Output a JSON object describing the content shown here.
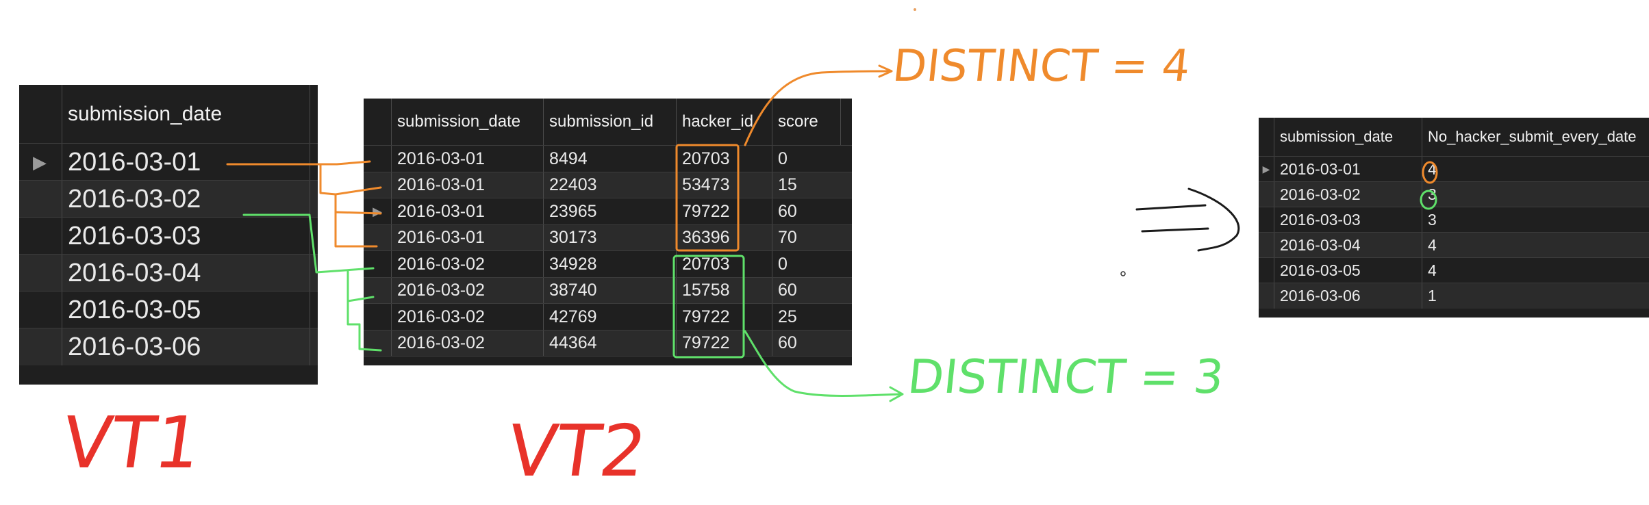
{
  "vt1": {
    "header": "submission_date",
    "rows": [
      "2016-03-01",
      "2016-03-02",
      "2016-03-03",
      "2016-03-04",
      "2016-03-05",
      "2016-03-06"
    ],
    "marker": "▶"
  },
  "vt2": {
    "headers": [
      "submission_date",
      "submission_id",
      "hacker_id",
      "score"
    ],
    "rows": [
      [
        "2016-03-01",
        "8494",
        "20703",
        "0"
      ],
      [
        "2016-03-01",
        "22403",
        "53473",
        "15"
      ],
      [
        "2016-03-01",
        "23965",
        "79722",
        "60"
      ],
      [
        "2016-03-01",
        "30173",
        "36396",
        "70"
      ],
      [
        "2016-03-02",
        "34928",
        "20703",
        "0"
      ],
      [
        "2016-03-02",
        "38740",
        "15758",
        "60"
      ],
      [
        "2016-03-02",
        "42769",
        "79722",
        "25"
      ],
      [
        "2016-03-02",
        "44364",
        "79722",
        "60"
      ]
    ]
  },
  "result": {
    "headers": [
      "submission_date",
      "No_hacker_submit_every_date"
    ],
    "rows": [
      [
        "2016-03-01",
        "4"
      ],
      [
        "2016-03-02",
        "3"
      ],
      [
        "2016-03-03",
        "3"
      ],
      [
        "2016-03-04",
        "4"
      ],
      [
        "2016-03-05",
        "4"
      ],
      [
        "2016-03-06",
        "1"
      ]
    ],
    "marker": "▶"
  },
  "annotations": {
    "distinct_top": "DISTINCT = 4",
    "distinct_bottom": "DISTINCT = 3",
    "vt1_label": "VT1",
    "vt2_label": "VT2",
    "arrow": "⇒"
  },
  "colors": {
    "orange": "#ef8a2c",
    "green": "#5fe06a",
    "red": "#e8322a",
    "table_bg": "#1f1f1f"
  }
}
